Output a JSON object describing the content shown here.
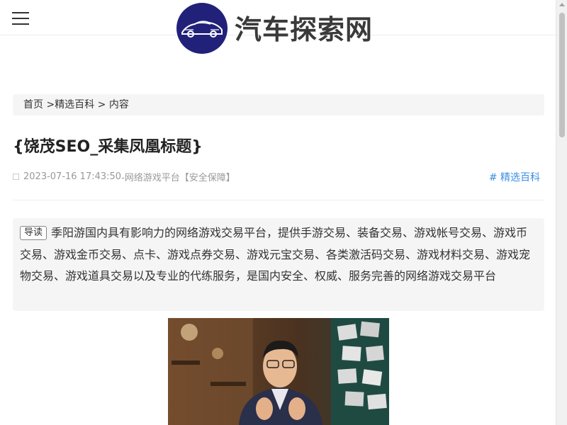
{
  "header": {
    "menu_icon": "hamburger-menu-icon",
    "logo_icon": "car-logo-icon",
    "site_name": "汽车探索网"
  },
  "breadcrumb": {
    "home": "首页",
    "sep1": " >",
    "category": "精选百科",
    "sep2": " > ",
    "current": "内容"
  },
  "article": {
    "title": "{饶茂SEO_采集凤凰标题}",
    "datetime": "2023-07-16 17:43:50",
    "source": " -网络游戏平台【安全保障】",
    "category_tag": "# 精选百科",
    "summary_label": "导读",
    "summary": "季阳游国内具有影响力的网络游戏交易平台，提供手游交易、装备交易、游戏帐号交易、游戏币交易、游戏金币交易、点卡、游戏点券交易、游戏元宝交易、各类激活码交易、游戏材料交易、游戏宠物交易、游戏道具交易以及专业的代练服务，是国内安全、权威、服务完善的网络游戏交易平台",
    "image_icon": "article-photo"
  },
  "colors": {
    "accent": "#3a8ee6",
    "logo_bg": "#22217a",
    "panel_bg": "#f5f5f5"
  }
}
